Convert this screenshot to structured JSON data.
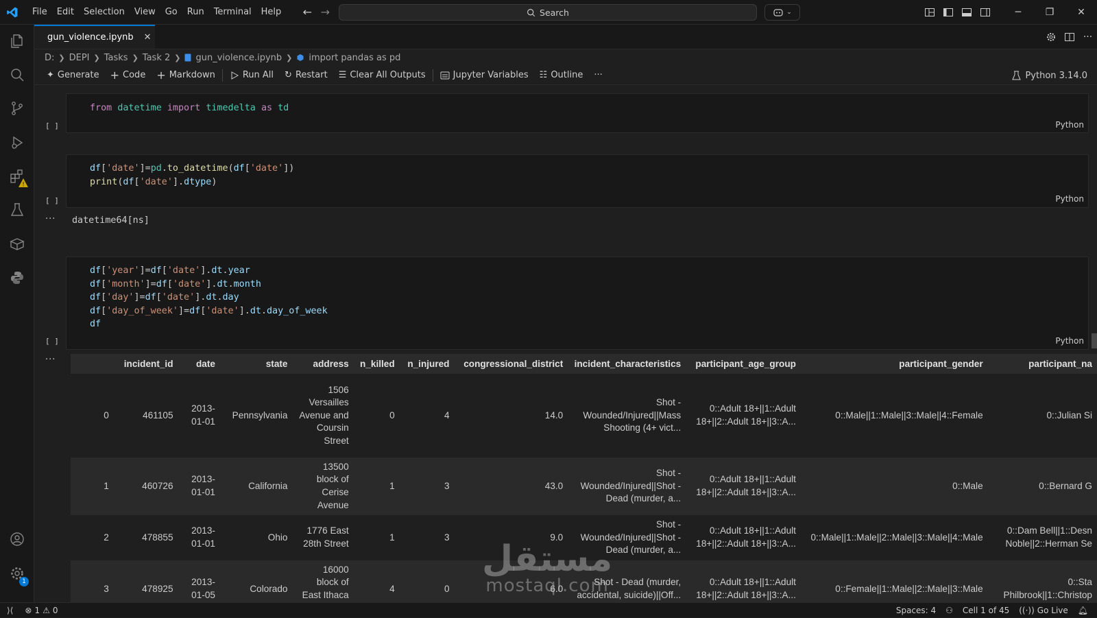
{
  "menu": [
    "File",
    "Edit",
    "Selection",
    "View",
    "Go",
    "Run",
    "Terminal",
    "Help"
  ],
  "search_label": "Search",
  "tab": {
    "filename": "gun_violence.ipynb"
  },
  "breadcrumb": [
    "D:",
    "DEPI",
    "Tasks",
    "Task 2",
    "gun_violence.ipynb",
    "import pandas as pd"
  ],
  "toolbar": {
    "generate": "Generate",
    "code": "Code",
    "markdown": "Markdown",
    "run_all": "Run All",
    "restart": "Restart",
    "clear_outputs": "Clear All Outputs",
    "jupyter_variables": "Jupyter Variables",
    "outline": "Outline",
    "more": "···",
    "kernel": "Python 3.14.0"
  },
  "cells": [
    {
      "exec": "[ ]",
      "lang": "Python"
    },
    {
      "exec": "[ ]",
      "lang": "Python",
      "output": "datetime64[ns]"
    },
    {
      "exec": "[ ]",
      "lang": "Python"
    }
  ],
  "output_dots": "···",
  "dataframe": {
    "columns": [
      "",
      "incident_id",
      "date",
      "state",
      "address",
      "n_killed",
      "n_injured",
      "congressional_district",
      "incident_characteristics",
      "participant_age_group",
      "participant_gender",
      "participant_na"
    ],
    "rows": [
      {
        "index": "0",
        "incident_id": "461105",
        "date": "2013-01-01",
        "state": "Pennsylvania",
        "address": "1506 Versailles Avenue and Coursin Street",
        "n_killed": "0",
        "n_injured": "4",
        "district": "14.0",
        "characteristics": "Shot - Wounded/Injured||Mass Shooting (4+ vict...",
        "age_group": "0::Adult 18+||1::Adult 18+||2::Adult 18+||3::A...",
        "gender": "0::Male||1::Male||3::Male||4::Female",
        "name": "0::Julian Si"
      },
      {
        "index": "1",
        "incident_id": "460726",
        "date": "2013-01-01",
        "state": "California",
        "address": "13500 block of Cerise Avenue",
        "n_killed": "1",
        "n_injured": "3",
        "district": "43.0",
        "characteristics": "Shot - Wounded/Injured||Shot - Dead (murder, a...",
        "age_group": "0::Adult 18+||1::Adult 18+||2::Adult 18+||3::A...",
        "gender": "0::Male",
        "name": "0::Bernard G"
      },
      {
        "index": "2",
        "incident_id": "478855",
        "date": "2013-01-01",
        "state": "Ohio",
        "address": "1776 East 28th Street",
        "n_killed": "1",
        "n_injured": "3",
        "district": "9.0",
        "characteristics": "Shot - Wounded/Injured||Shot - Dead (murder, a...",
        "age_group": "0::Adult 18+||1::Adult 18+||2::Adult 18+||3::A...",
        "gender": "0::Male||1::Male||2::Male||3::Male||4::Male",
        "name": "0::Dam Bell||1::Desn Noble||2::Herman Se"
      },
      {
        "index": "3",
        "incident_id": "478925",
        "date": "2013-01-05",
        "state": "Colorado",
        "address": "16000 block of East Ithaca Place",
        "n_killed": "4",
        "n_injured": "0",
        "district": "6.0",
        "characteristics": "Shot - Dead (murder, accidental, suicide)||Off...",
        "age_group": "0::Adult 18+||1::Adult 18+||2::Adult 18+||3::A...",
        "gender": "0::Female||1::Male||2::Male||3::Male",
        "name": "0::Sta Philbrook||1::Christop"
      }
    ]
  },
  "status": {
    "errors": "1",
    "warnings": "0",
    "spaces": "Spaces: 4",
    "cell": "Cell 1 of 45",
    "golive": "Go Live"
  },
  "activity_badge": "1",
  "watermark": {
    "arabic": "مستقل",
    "latin": "mostaql.com"
  },
  "colors": {
    "accent": "#0078d4",
    "keyword": "#c586c0",
    "module": "#4ec9b0",
    "string": "#ce9178",
    "variable": "#9cdcfe",
    "function": "#dcdcaa",
    "warning": "#cca700"
  },
  "icons": [
    "vscode-logo-icon",
    "search-icon",
    "arrow-left-icon",
    "arrow-right-icon",
    "copilot-icon",
    "layout-icon",
    "panel-icon",
    "notebook-icon",
    "close-icon",
    "gear-icon",
    "split-icon",
    "explorer-icon",
    "source-control-icon",
    "run-debug-icon",
    "extensions-icon",
    "testing-icon",
    "remote-icon",
    "python-icon",
    "account-icon",
    "manage-icon",
    "remote-status-icon",
    "error-icon",
    "warning-icon",
    "bell-icon"
  ]
}
